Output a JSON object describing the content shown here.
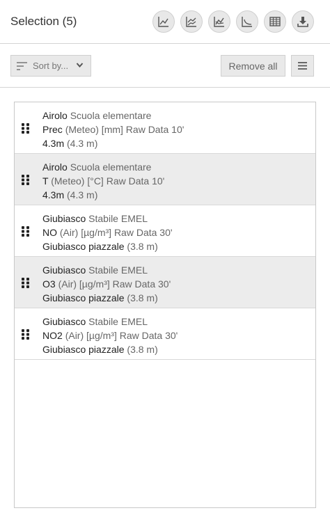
{
  "header": {
    "title": "Selection (5)",
    "icons": [
      "line-chart-icon",
      "area-chart-icon",
      "multi-line-chart-icon",
      "scatter-chart-icon",
      "table-icon",
      "download-icon"
    ]
  },
  "toolbar": {
    "sort_label": "Sort by...",
    "remove_all_label": "Remove all"
  },
  "items": [
    {
      "station": "Airolo",
      "station_desc": "Scuola elementare",
      "param": "Prec",
      "param_desc": "(Meteo) [mm] Raw Data 10'",
      "location": "4.3m",
      "height": "(4.3 m)"
    },
    {
      "station": "Airolo",
      "station_desc": "Scuola elementare",
      "param": "T",
      "param_desc": "(Meteo) [°C] Raw Data 10'",
      "location": "4.3m",
      "height": "(4.3 m)"
    },
    {
      "station": "Giubiasco",
      "station_desc": "Stabile EMEL",
      "param": "NO",
      "param_desc": "(Air) [µg/m³] Raw Data 30'",
      "location": "Giubiasco piazzale",
      "height": "(3.8 m)"
    },
    {
      "station": "Giubiasco",
      "station_desc": "Stabile EMEL",
      "param": "O3",
      "param_desc": "(Air) [µg/m³] Raw Data 30'",
      "location": "Giubiasco piazzale",
      "height": "(3.8 m)"
    },
    {
      "station": "Giubiasco",
      "station_desc": "Stabile EMEL",
      "param": "NO2",
      "param_desc": "(Air) [µg/m³] Raw Data 30'",
      "location": "Giubiasco piazzale",
      "height": "(3.8 m)"
    }
  ]
}
